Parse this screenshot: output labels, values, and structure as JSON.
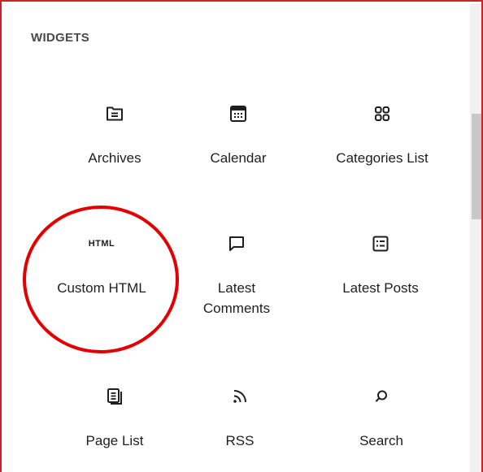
{
  "panel": {
    "section_title": "WIDGETS"
  },
  "widgets": [
    {
      "label": "Archives",
      "icon": "archive-folder-icon"
    },
    {
      "label": "Calendar",
      "icon": "calendar-icon"
    },
    {
      "label": "Categories List",
      "icon": "categories-grid-icon"
    },
    {
      "label": "Custom HTML",
      "icon": "html-icon",
      "icon_text": "HTML"
    },
    {
      "label": "Latest Comments",
      "label_line1": "Latest",
      "label_line2": "Comments",
      "icon": "comment-bubble-icon"
    },
    {
      "label": "Latest Posts",
      "icon": "post-list-icon"
    },
    {
      "label": "Page List",
      "icon": "page-list-icon"
    },
    {
      "label": "RSS",
      "icon": "rss-icon"
    },
    {
      "label": "Search",
      "icon": "search-icon"
    }
  ],
  "colors": {
    "frame_border": "#cc2229",
    "annotation": "#e30000",
    "text": "#1e1e1e",
    "scrollbar_track": "#f1f1f1",
    "scrollbar_thumb": "#c8c8c8"
  }
}
